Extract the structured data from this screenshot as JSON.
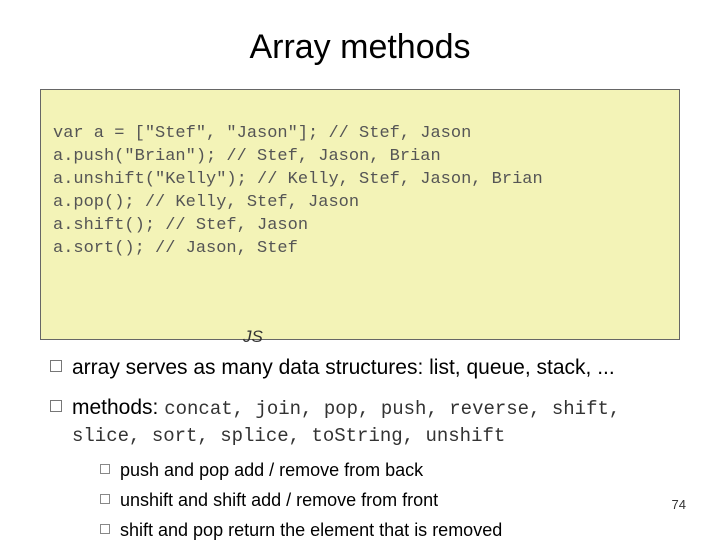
{
  "title": "Array methods",
  "code": {
    "line1": "var a = [\"Stef\", \"Jason\"]; // Stef, Jason",
    "line2": "a.push(\"Brian\"); // Stef, Jason, Brian",
    "line3": "a.unshift(\"Kelly\"); // Kelly, Stef, Jason, Brian",
    "line4": "a.pop(); // Kelly, Stef, Jason",
    "line5": "a.shift(); // Stef, Jason",
    "line6": "a.sort(); // Jason, Stef",
    "badge": "JS"
  },
  "bullets": {
    "b1": "array serves as many data structures: list, queue, stack, ...",
    "b2_lead": "methods: ",
    "b2_code": "concat, join, pop, push, reverse, shift, slice, sort, splice, toString, unshift",
    "sub1": "push and pop add / remove from back",
    "sub2": "unshift and shift add / remove from front",
    "sub3": "shift and pop return the element that is removed"
  },
  "pagenum": "74"
}
